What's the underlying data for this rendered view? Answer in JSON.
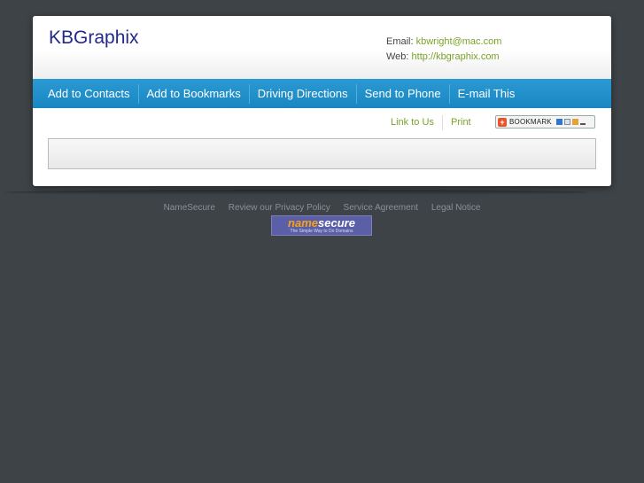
{
  "site": {
    "title": "KBGraphix"
  },
  "contact": {
    "email_label": "Email:",
    "email": "kbwright@mac.com",
    "web_label": "Web:",
    "web": "http://kbgraphix.com"
  },
  "nav": {
    "items": [
      {
        "label": "Add to Contacts"
      },
      {
        "label": "Add to Bookmarks"
      },
      {
        "label": "Driving Directions"
      },
      {
        "label": "Send to Phone"
      },
      {
        "label": "E-mail This"
      }
    ]
  },
  "tools": {
    "link_to_us": "Link to Us",
    "print": "Print",
    "bookmark_label": "BOOKMARK"
  },
  "footer": {
    "links": [
      "NameSecure",
      "Review our Privacy Policy",
      "Service Agreement",
      "Legal Notice"
    ]
  },
  "logo": {
    "name": "name",
    "secure": "secure",
    "tagline": "The Simple Way to Do Domains"
  },
  "colors": {
    "background": "#3d4347",
    "nav_bar": "#2a9ad3",
    "title": "#22288c",
    "link": "#7aa228"
  }
}
